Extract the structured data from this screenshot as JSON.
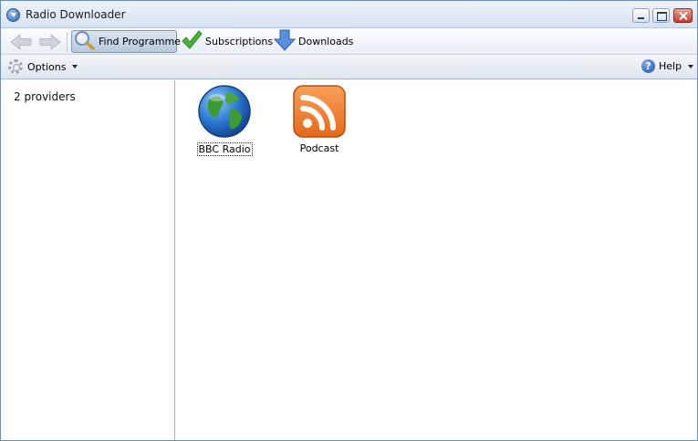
{
  "window": {
    "title": "Radio Downloader"
  },
  "toolbar": {
    "find_label": "Find Programme",
    "subscriptions_label": "Subscriptions",
    "downloads_label": "Downloads"
  },
  "optionsbar": {
    "options_label": "Options",
    "help_label": "Help"
  },
  "sidebar": {
    "provider_count": "2 providers"
  },
  "providers": [
    {
      "name": "BBC Radio",
      "icon": "globe-icon",
      "selected": true
    },
    {
      "name": "Podcast",
      "icon": "rss-icon",
      "selected": false
    }
  ],
  "colors": {
    "accent": "#7f95b4",
    "rss": "#f07d1f",
    "check": "#3aa62e",
    "download_arrow": "#4f86d9"
  }
}
